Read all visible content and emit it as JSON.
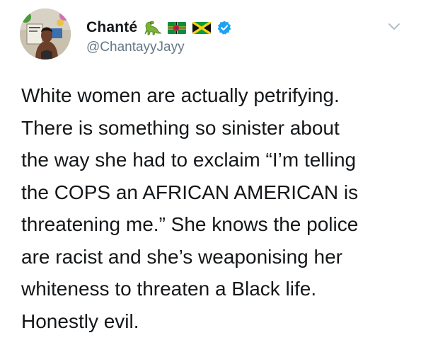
{
  "tweet": {
    "author": {
      "display_name": "Chanté",
      "handle": "@ChantayyJayy",
      "badges": [
        "dinosaur-emoji",
        "dominica-flag-emoji",
        "jamaica-flag-emoji",
        "verified-badge-icon"
      ]
    },
    "text_lines": [
      "White women are actually petrifying.",
      "There is something so sinister about",
      "the way she had to exclaim “I’m telling",
      "the COPS an AFRICAN AMERICAN is",
      "threatening me.” She knows the police",
      "are racist and she’s weaponising her",
      "whiteness to threaten a Black life.",
      "Honestly evil."
    ],
    "menu_icon": "chevron-down-icon"
  },
  "colors": {
    "text_primary": "#14171a",
    "text_secondary": "#657786",
    "verified_blue": "#1da1f2",
    "chevron_gray": "#aab8c2"
  }
}
